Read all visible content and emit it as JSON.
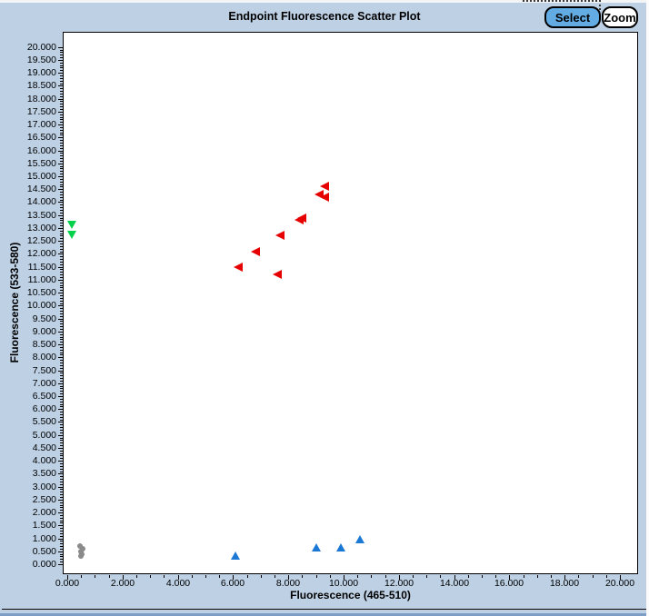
{
  "window": {
    "title": "Endpoint Fluorescence Scatter Plot",
    "buttons": [
      {
        "label": "Select",
        "active": true
      },
      {
        "label": "Zoom",
        "active": false
      }
    ]
  },
  "colors": {
    "background": "#bdd0e4",
    "plot_background": "#ffffff",
    "plot_border": "#000000",
    "select_button_active": "#63ace3",
    "button_inactive": "#ffffff",
    "series_red": "#e60000",
    "series_green": "#00d04a",
    "series_blue": "#1b79d5",
    "series_gray": "#8a8a8a"
  },
  "chart_data": {
    "type": "scatter",
    "title": "Endpoint Fluorescence Scatter Plot",
    "xlabel": "Fluorescence (465-510)",
    "ylabel": "Fluorescence (533-580)",
    "xlim": [
      0,
      20
    ],
    "ylim": [
      0,
      20
    ],
    "x_major_step": 2.0,
    "x_minor_step": 0.5,
    "y_major_step": 0.5,
    "y_minor_step": 0.1,
    "tick_label_decimals": 3,
    "grid": false,
    "legend": false,
    "series": [
      {
        "name": "red-left-triangles",
        "marker": "triangle-left",
        "color": "#e60000",
        "points": [
          [
            6.2,
            11.5
          ],
          [
            6.8,
            12.1
          ],
          [
            7.6,
            11.2
          ],
          [
            7.7,
            12.7
          ],
          [
            8.4,
            13.3
          ],
          [
            8.5,
            13.4
          ],
          [
            9.1,
            14.3
          ],
          [
            9.3,
            14.2
          ],
          [
            9.3,
            14.6
          ]
        ]
      },
      {
        "name": "green-down-triangles",
        "marker": "triangle-down",
        "color": "#00d04a",
        "points": [
          [
            0.15,
            13.1
          ],
          [
            0.15,
            12.7
          ]
        ]
      },
      {
        "name": "blue-up-triangles",
        "marker": "triangle-up",
        "color": "#1b79d5",
        "points": [
          [
            6.1,
            0.35
          ],
          [
            9.0,
            0.65
          ],
          [
            9.9,
            0.65
          ],
          [
            10.6,
            1.0
          ]
        ]
      },
      {
        "name": "gray-circles",
        "marker": "circle",
        "color": "#8a8a8a",
        "points": [
          [
            0.45,
            0.7
          ],
          [
            0.55,
            0.6
          ],
          [
            0.48,
            0.48
          ],
          [
            0.53,
            0.38
          ],
          [
            0.5,
            0.3
          ]
        ]
      }
    ]
  }
}
